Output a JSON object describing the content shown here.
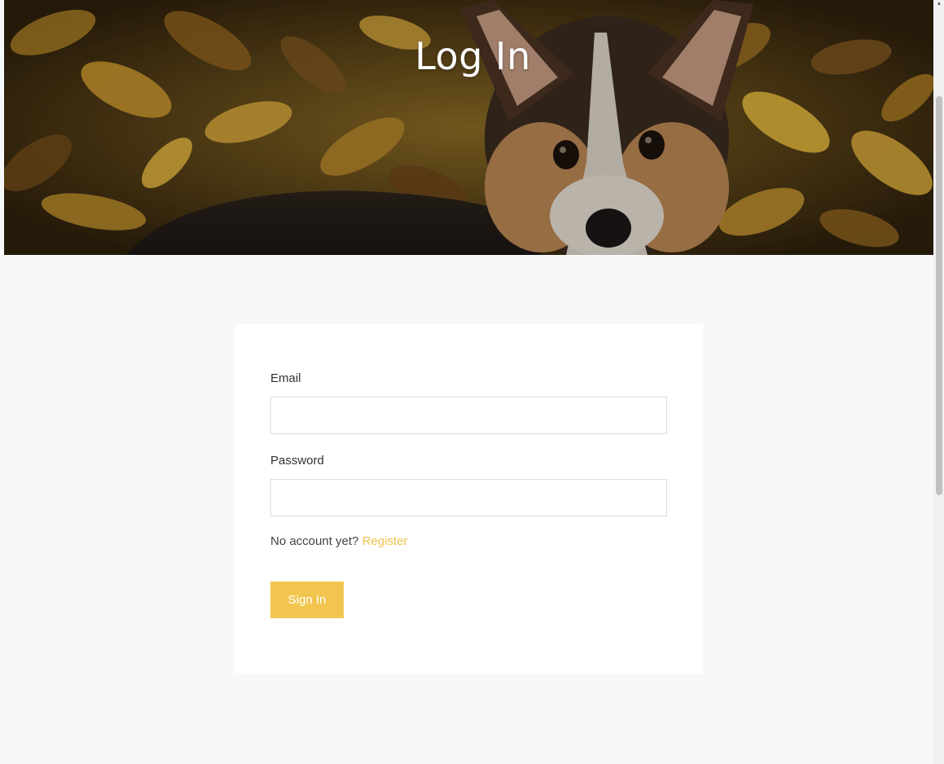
{
  "hero": {
    "title": "Log In"
  },
  "form": {
    "email_label": "Email",
    "email_value": "",
    "password_label": "Password",
    "password_value": "",
    "no_account_text": "No account yet?",
    "register_link": "Register",
    "signin_label": "Sign In"
  },
  "colors": {
    "accent": "#f2c54f",
    "link": "#f0c34d",
    "page_background": "#f7f8fa",
    "card_background": "#ffffff"
  }
}
